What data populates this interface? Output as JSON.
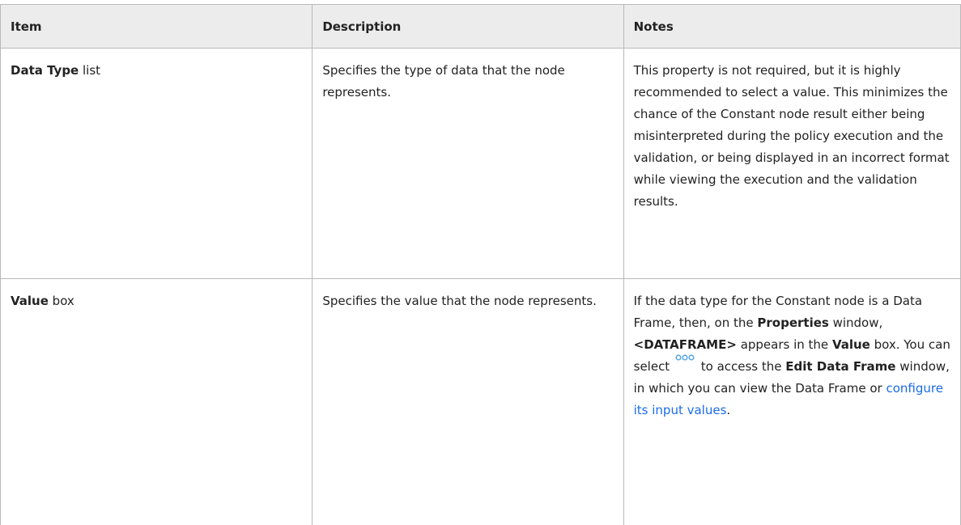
{
  "table": {
    "headers": [
      "Item",
      "Description",
      "Notes"
    ],
    "rows": [
      {
        "item_bold": "Data Type",
        "item_rest": " list",
        "description": "Specifies the type of data that the node represents.",
        "notes": "This property is not required, but it is highly recommended to select a value. This minimizes the chance of the Constant node result either being misinterpreted during the policy execution and the validation, or being displayed in an incorrect format while viewing the execution and the validation results."
      },
      {
        "item_bold": "Value",
        "item_rest": " box",
        "description": "Specifies the value that the node represents.",
        "notes_parts": {
          "p1": "If the data type for the Constant node is a Data Frame, then, on the ",
          "b1": "Properties",
          "p2": " window, ",
          "b2": "<DATAFRAME>",
          "p3": " appears in the ",
          "b3": "Value",
          "p4": " box. You can select ",
          "icon": "ellipsis-button-icon",
          "p5": " to access the ",
          "b4": "Edit Data Frame",
          "p6": " window, in which you can view the Data Frame or ",
          "link": "configure its input values",
          "p7": "."
        }
      }
    ]
  },
  "colors": {
    "header_bg": "#ececec",
    "border": "#b9b9b9",
    "link": "#1a6ce8",
    "icon": "#5aa9e6"
  }
}
